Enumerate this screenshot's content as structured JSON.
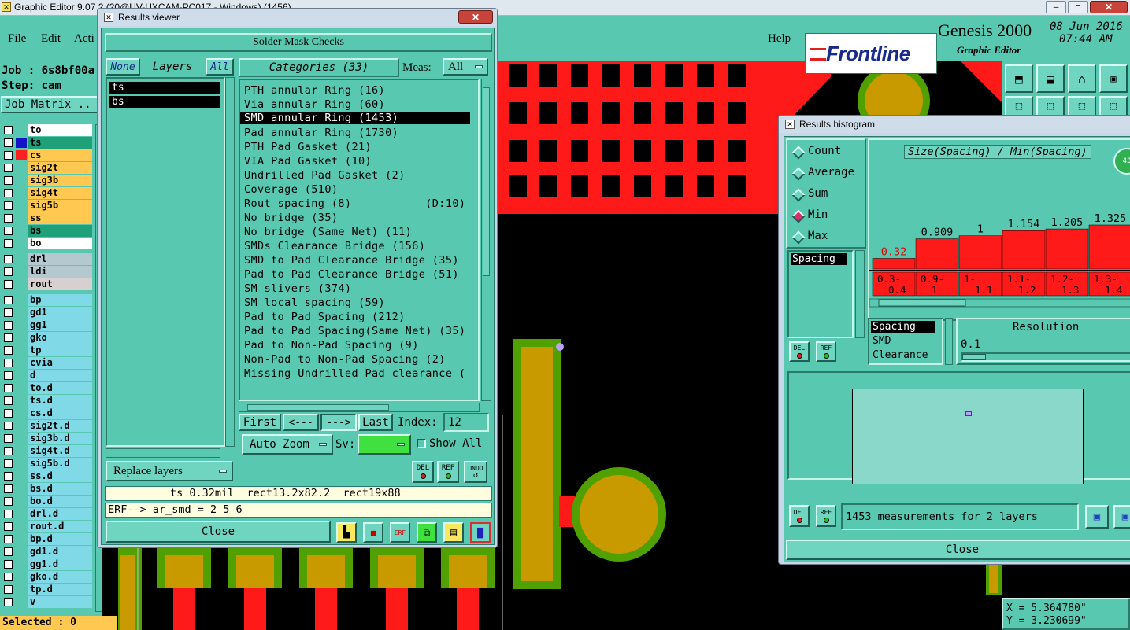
{
  "main": {
    "title": "Graphic Editor 9.07  2 (20@UV-UXCAM-PC017 - Windows)  (1456)",
    "menu": [
      "File",
      "Edit",
      "Acti"
    ],
    "help": "Help",
    "job": "Job : 6s8bf00a",
    "step": "Step: cam",
    "job_matrix": "Job Matrix ..",
    "brand": "Frontline",
    "product": "Genesis 2000",
    "subtitle": "Graphic Editor",
    "date": "08 Jun 2016",
    "time": "07:44 AM",
    "selected": "Selected : 0",
    "coord_x": "X = 5.364780\"",
    "coord_y": "Y = 3.230699\""
  },
  "layers": [
    {
      "name": "to",
      "color": "#ffffff",
      "ind": ""
    },
    {
      "name": "ts",
      "color": "#1ea078",
      "ind": "#1414c8"
    },
    {
      "name": "cs",
      "color": "#ffc850",
      "ind": "#ff2020"
    },
    {
      "name": "sig2t",
      "color": "#ffc850",
      "ind": ""
    },
    {
      "name": "sig3b",
      "color": "#ffc850",
      "ind": ""
    },
    {
      "name": "sig4t",
      "color": "#ffc850",
      "ind": ""
    },
    {
      "name": "sig5b",
      "color": "#ffc850",
      "ind": ""
    },
    {
      "name": "ss",
      "color": "#ffc850",
      "ind": ""
    },
    {
      "name": "bs",
      "color": "#1ea078",
      "ind": ""
    },
    {
      "name": "bo",
      "color": "#ffffff",
      "ind": ""
    },
    {
      "name": "drl",
      "color": "#b4c8d0",
      "ind": ""
    },
    {
      "name": "ldi",
      "color": "#b4c8d0",
      "ind": ""
    },
    {
      "name": "rout",
      "color": "#d8d0d0",
      "ind": ""
    },
    {
      "name": "bp",
      "color": "#7fd9e6",
      "ind": ""
    },
    {
      "name": "gd1",
      "color": "#7fd9e6",
      "ind": ""
    },
    {
      "name": "gg1",
      "color": "#7fd9e6",
      "ind": ""
    },
    {
      "name": "gko",
      "color": "#7fd9e6",
      "ind": ""
    },
    {
      "name": "tp",
      "color": "#7fd9e6",
      "ind": ""
    },
    {
      "name": "cvia",
      "color": "#7fd9e6",
      "ind": ""
    },
    {
      "name": "d",
      "color": "#7fd9e6",
      "ind": ""
    },
    {
      "name": "to.d",
      "color": "#7fd9e6",
      "ind": ""
    },
    {
      "name": "ts.d",
      "color": "#7fd9e6",
      "ind": ""
    },
    {
      "name": "cs.d",
      "color": "#7fd9e6",
      "ind": ""
    },
    {
      "name": "sig2t.d",
      "color": "#7fd9e6",
      "ind": ""
    },
    {
      "name": "sig3b.d",
      "color": "#7fd9e6",
      "ind": ""
    },
    {
      "name": "sig4t.d",
      "color": "#7fd9e6",
      "ind": ""
    },
    {
      "name": "sig5b.d",
      "color": "#7fd9e6",
      "ind": ""
    },
    {
      "name": "ss.d",
      "color": "#7fd9e6",
      "ind": ""
    },
    {
      "name": "bs.d",
      "color": "#7fd9e6",
      "ind": ""
    },
    {
      "name": "bo.d",
      "color": "#7fd9e6",
      "ind": ""
    },
    {
      "name": "drl.d",
      "color": "#7fd9e6",
      "ind": ""
    },
    {
      "name": "rout.d",
      "color": "#7fd9e6",
      "ind": ""
    },
    {
      "name": "bp.d",
      "color": "#7fd9e6",
      "ind": ""
    },
    {
      "name": "gd1.d",
      "color": "#7fd9e6",
      "ind": ""
    },
    {
      "name": "gg1.d",
      "color": "#7fd9e6",
      "ind": ""
    },
    {
      "name": "gko.d",
      "color": "#7fd9e6",
      "ind": ""
    },
    {
      "name": "tp.d",
      "color": "#7fd9e6",
      "ind": ""
    },
    {
      "name": "v",
      "color": "#7fd9e6",
      "ind": ""
    }
  ],
  "results_viewer": {
    "window_title": "Results viewer",
    "header": "Solder Mask Checks",
    "none_btn": "None",
    "layers_label": "Layers",
    "all_btn": "All",
    "categories_label": "Categories (33)",
    "meas_label": "Meas:",
    "meas_value": "All",
    "selected_layers": [
      "ts",
      "bs"
    ],
    "categories": [
      "PTH annular Ring (16)",
      "Via annular Ring (60)",
      "SMD annular Ring (1453)",
      "Pad annular Ring (1730)",
      "PTH Pad Gasket (21)",
      "VIA Pad Gasket (10)",
      "Undrilled Pad Gasket (2)",
      "Coverage (510)",
      "Rout spacing (8)           (D:10)",
      "No bridge (35)",
      "No bridge (Same Net) (11)",
      "SMDs Clearance Bridge (156)",
      "SMD to Pad Clearance Bridge (35)",
      "Pad to Pad Clearance Bridge (51)",
      "SM slivers (374)",
      "SM local spacing (59)",
      "Pad to Pad Spacing (212)",
      "Pad to Pad Spacing(Same Net) (35)",
      "Pad to Non-Pad Spacing (9)",
      "Non-Pad to Non-Pad Spacing (2)",
      "Missing Undrilled Pad clearance ("
    ],
    "selected_index": 2,
    "first_btn": "First",
    "prev_btn": "<---",
    "next_btn": "--->",
    "last_btn": "Last",
    "index_label": "Index:",
    "index_value": "12",
    "auto_zoom": "Auto Zoom",
    "sv_label": "Sv:",
    "show_all": "Show All",
    "replace_layers": "Replace layers",
    "del": "DEL",
    "ref": "REF",
    "undo": "UNDO",
    "status_line": "ts 0.32mil  rect13.2x82.2  rect19x88",
    "erf_line": "ERF--> ar_smd = 2 5 6",
    "close": "Close",
    "erf_icon": "ERF"
  },
  "histogram": {
    "window_title": "Results histogram",
    "radios": [
      "Count",
      "Average",
      "Sum",
      "Min",
      "Max"
    ],
    "radio_selected": 3,
    "title": "Size(Spacing) / Min(Spacing)",
    "attr_list": [
      "Spacing"
    ],
    "bars": [
      {
        "value": 0.32,
        "label": "0.32",
        "range": [
          "0.3-",
          "0.4"
        ]
      },
      {
        "value": 0.909,
        "label": "0.909",
        "range": [
          "0.9-",
          "1"
        ]
      },
      {
        "value": 1,
        "label": "1",
        "range": [
          "1-",
          "1.1"
        ]
      },
      {
        "value": 1.154,
        "label": "1.154",
        "range": [
          "1.1-",
          "1.2"
        ]
      },
      {
        "value": 1.205,
        "label": "1.205",
        "range": [
          "1.2-",
          "1.3"
        ]
      },
      {
        "value": 1.325,
        "label": "1.325",
        "range": [
          "1.3-",
          "1.4"
        ]
      }
    ],
    "field_list": [
      "Spacing",
      "SMD",
      "Clearance"
    ],
    "resolution_label": "Resolution",
    "resolution_value": "0.1",
    "summary": "1453 measurements for 2 layers",
    "close": "Close",
    "del": "DEL",
    "ref": "REF",
    "badge": "43"
  },
  "colors": {
    "panel": "#58c8b0",
    "pcb_red": "#ff1a1a",
    "pcb_gold": "#c89a00",
    "pcb_green": "#4fa000"
  }
}
